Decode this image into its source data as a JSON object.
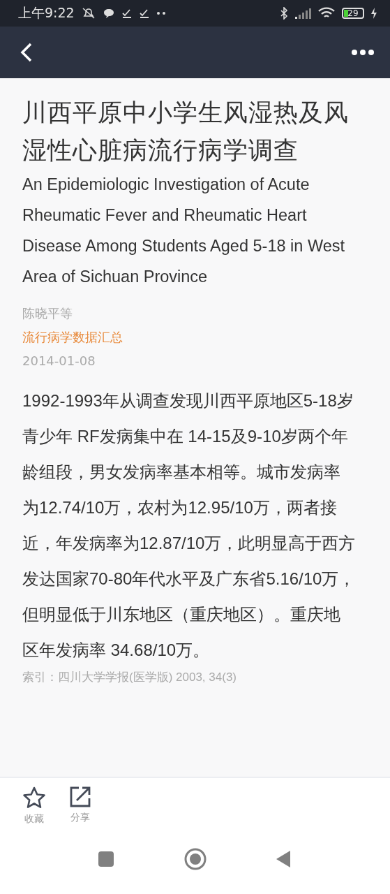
{
  "status_bar": {
    "time": "上午9:22",
    "battery": "29"
  },
  "article": {
    "title": "川西平原中小学生风湿热及风湿性心脏病流行病学调查",
    "subtitle": "An Epidemiologic Investigation of Acute Rheumatic Fever and Rheumatic Heart Disease Among Students Aged 5-18 in West Area of Sichuan Province",
    "authors": "陈晓平等",
    "source": "流行病学数据汇总",
    "date": "2014-01-08",
    "body": "1992-1993年从调查发现川西平原地区5-18岁青少年 RF发病集中在 14-15及9-10岁两个年龄组段，男女发病率基本相等。城市发病率为12.74/10万，农村为12.95/10万，两者接近，年发病率为12.87/10万，此明显高于西方发达国家70-80年代水平及广东省5.16/10万，但明显低于川东地区（重庆地区）。重庆地区年发病率 34.68/10万。",
    "citation": "索引：四川大学学报(医学版) 2003, 34(3)"
  },
  "actions": [
    {
      "kind": "favorite",
      "label": "收藏"
    },
    {
      "kind": "share",
      "label": "分享"
    }
  ]
}
